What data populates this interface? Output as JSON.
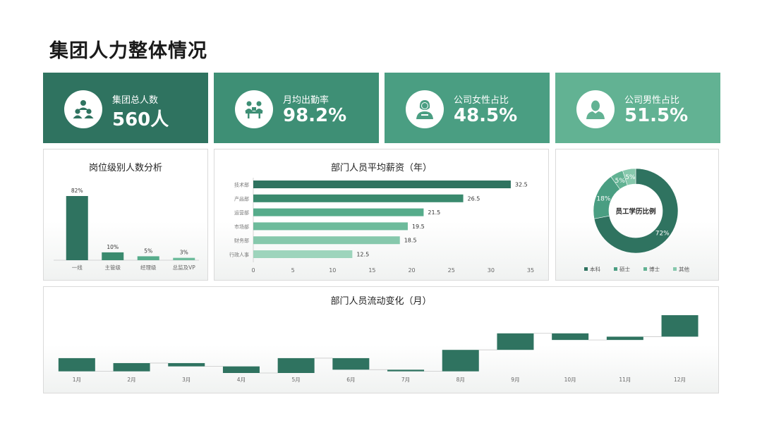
{
  "page_title": "集团人力整体情况",
  "colors": {
    "dark": "#2f7360",
    "mid": "#3e8f75",
    "light": "#4a9e82",
    "lighter": "#62b293",
    "bar2": "#3a8a6e",
    "bar3": "#56ac8b",
    "bar4": "#6dbb9b",
    "bar5": "#86c8ac",
    "bar6": "#9dd4bc"
  },
  "kpis": [
    {
      "label": "集团总人数",
      "value": "560人",
      "icon": "team-icon"
    },
    {
      "label": "月均出勤率",
      "value": "98.2%",
      "icon": "meeting-icon"
    },
    {
      "label": "公司女性占比",
      "value": "48.5%",
      "icon": "female-icon"
    },
    {
      "label": "公司男性占比",
      "value": "51.5%",
      "icon": "male-icon"
    }
  ],
  "chart_data": [
    {
      "type": "bar",
      "title": "岗位级别人数分析",
      "categories": [
        "一线",
        "主管级",
        "经理级",
        "总监及VP"
      ],
      "values": [
        82,
        10,
        5,
        3
      ],
      "value_labels": [
        "82%",
        "10%",
        "5%",
        "3%"
      ],
      "ylim": [
        0,
        100
      ],
      "grid": false
    },
    {
      "type": "bar",
      "orientation": "horizontal",
      "title": "部门人员平均薪资（年）",
      "categories": [
        "技术部",
        "产品部",
        "运营部",
        "市场部",
        "财务部",
        "行政人事"
      ],
      "values": [
        32.5,
        26.5,
        21.5,
        19.5,
        18.5,
        12.5
      ],
      "xlim": [
        0,
        35
      ],
      "xticks": [
        "0",
        "5",
        "10",
        "15",
        "20",
        "25",
        "30",
        "35"
      ],
      "grid": false
    },
    {
      "type": "pie",
      "donut": true,
      "center_label": "员工学历比例",
      "categories": [
        "本科",
        "硕士",
        "博士",
        "其他"
      ],
      "values": [
        72,
        18,
        5,
        5
      ],
      "value_labels": [
        "72%",
        "18%",
        "5%",
        "5%"
      ],
      "legend": "bottom"
    },
    {
      "type": "bar",
      "subtype": "waterfall",
      "title": "部门人员流动变化（月）",
      "categories": [
        "1月",
        "2月",
        "3月",
        "4月",
        "5月",
        "6月",
        "7月",
        "8月",
        "9月",
        "10月",
        "11月",
        "12月"
      ],
      "values": [
        -8,
        5,
        -2,
        -4,
        9,
        -7,
        -1,
        13,
        10,
        -4,
        2,
        13
      ],
      "grid": false
    }
  ]
}
